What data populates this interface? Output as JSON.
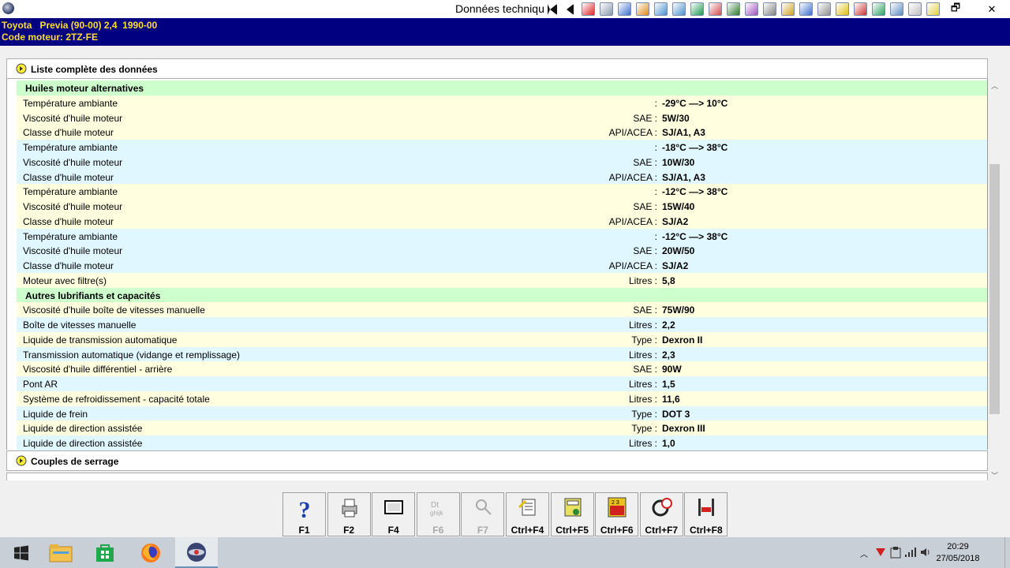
{
  "window": {
    "title": "Données techniqu",
    "toolbar_icons": [
      "first-record-icon",
      "previous-record-icon",
      "warning-icon",
      "document-icon",
      "chart-icon",
      "tyre-icon",
      "gauge-icon",
      "settings-icon",
      "engine-icon",
      "exhaust-icon",
      "car-lift-icon",
      "wrench-icon",
      "spark-plug-icon",
      "brake-icon",
      "car-icon",
      "car-side-icon",
      "smiley-icon",
      "fuel-icon",
      "circuit-icon",
      "globe-icon",
      "help-doc-icon",
      "notepad-icon"
    ],
    "restore_glyph": "🗗",
    "close_glyph": "✕"
  },
  "vehicle": {
    "line1": "Toyota   Previa (90-00) 2,4  1990-00",
    "line2": "Code moteur: 2TZ-FE"
  },
  "sections": {
    "liste": "Liste complète des données",
    "couples": "Couples de serrage"
  },
  "rows": [
    {
      "type": "head",
      "label": "Huiles moteur alternatives"
    },
    {
      "label": "Température ambiante",
      "unit": ":",
      "value": "-29°C —> 10°C",
      "bg": "y"
    },
    {
      "label": "Viscosité d'huile moteur",
      "unit": "SAE :",
      "value": "5W/30",
      "bg": "y"
    },
    {
      "label": "Classe d'huile moteur",
      "unit": "API/ACEA :",
      "value": "SJ/A1, A3",
      "bg": "y"
    },
    {
      "label": "Température ambiante",
      "unit": ":",
      "value": "-18°C —> 38°C",
      "bg": "b"
    },
    {
      "label": "Viscosité d'huile moteur",
      "unit": "SAE :",
      "value": "10W/30",
      "bg": "b"
    },
    {
      "label": "Classe d'huile moteur",
      "unit": "API/ACEA :",
      "value": "SJ/A1, A3",
      "bg": "b"
    },
    {
      "label": "Température ambiante",
      "unit": ":",
      "value": "-12°C —> 38°C",
      "bg": "y"
    },
    {
      "label": "Viscosité d'huile moteur",
      "unit": "SAE :",
      "value": "15W/40",
      "bg": "y"
    },
    {
      "label": "Classe d'huile moteur",
      "unit": "API/ACEA :",
      "value": "SJ/A2",
      "bg": "y"
    },
    {
      "label": "Température ambiante",
      "unit": ":",
      "value": "-12°C —> 38°C",
      "bg": "b"
    },
    {
      "label": "Viscosité d'huile moteur",
      "unit": "SAE :",
      "value": "20W/50",
      "bg": "b"
    },
    {
      "label": "Classe d'huile moteur",
      "unit": "API/ACEA :",
      "value": "SJ/A2",
      "bg": "b"
    },
    {
      "label": "Moteur avec filtre(s)",
      "unit": "Litres :",
      "value": "5,8",
      "bg": "y"
    },
    {
      "type": "head",
      "label": "Autres lubrifiants et capacités"
    },
    {
      "label": "Viscosité d'huile boîte de vitesses manuelle",
      "unit": "SAE :",
      "value": "75W/90",
      "bg": "y"
    },
    {
      "label": "Boîte de vitesses manuelle",
      "unit": "Litres :",
      "value": "2,2",
      "bg": "b"
    },
    {
      "label": "Liquide de transmission automatique",
      "unit": "Type :",
      "value": "Dexron II",
      "bg": "y"
    },
    {
      "label": "Transmission automatique (vidange et remplissage)",
      "unit": "Litres :",
      "value": "2,3",
      "bg": "b"
    },
    {
      "label": "Viscosité d'huile différentiel - arrière",
      "unit": "SAE :",
      "value": "90W",
      "bg": "y"
    },
    {
      "label": "Pont AR",
      "unit": "Litres :",
      "value": "1,5",
      "bg": "b"
    },
    {
      "label": "Système de refroidissement - capacité totale",
      "unit": "Litres :",
      "value": "11,6",
      "bg": "y"
    },
    {
      "label": "Liquide de frein",
      "unit": "Type :",
      "value": "DOT 3",
      "bg": "b"
    },
    {
      "label": "Liquide de direction assistée",
      "unit": "Type :",
      "value": "Dexron III",
      "bg": "y"
    },
    {
      "label": "Liquide de direction assistée",
      "unit": "Litres :",
      "value": "1,0",
      "bg": "b"
    }
  ],
  "fkeys": [
    {
      "label": "F1",
      "icon": "help-icon",
      "enabled": true
    },
    {
      "label": "F2",
      "icon": "print-icon",
      "enabled": true
    },
    {
      "label": "F4",
      "icon": "screen-icon",
      "enabled": true
    },
    {
      "label": "F6",
      "icon": "font-icon",
      "enabled": false
    },
    {
      "label": "F7",
      "icon": "search-icon",
      "enabled": false
    },
    {
      "label": "Ctrl+F4",
      "icon": "notes-icon",
      "enabled": true
    },
    {
      "label": "Ctrl+F5",
      "icon": "calculator-icon",
      "enabled": true
    },
    {
      "label": "Ctrl+F6",
      "icon": "timer-icon",
      "enabled": true
    },
    {
      "label": "Ctrl+F7",
      "icon": "wheel-gauge-icon",
      "enabled": true
    },
    {
      "label": "Ctrl+F8",
      "icon": "car-lift-icon",
      "enabled": true
    }
  ],
  "taskbar": {
    "apps": [
      "start-icon",
      "file-explorer-icon",
      "store-icon",
      "firefox-icon",
      "app-icon"
    ],
    "time": "20:29",
    "date": "27/05/2018"
  },
  "colors": {
    "header_bg": "#000080",
    "header_text": "#ffdd33",
    "section_head": "#ccffcc",
    "row_yellow": "#ffffe0",
    "row_blue": "#e0f7ff"
  }
}
